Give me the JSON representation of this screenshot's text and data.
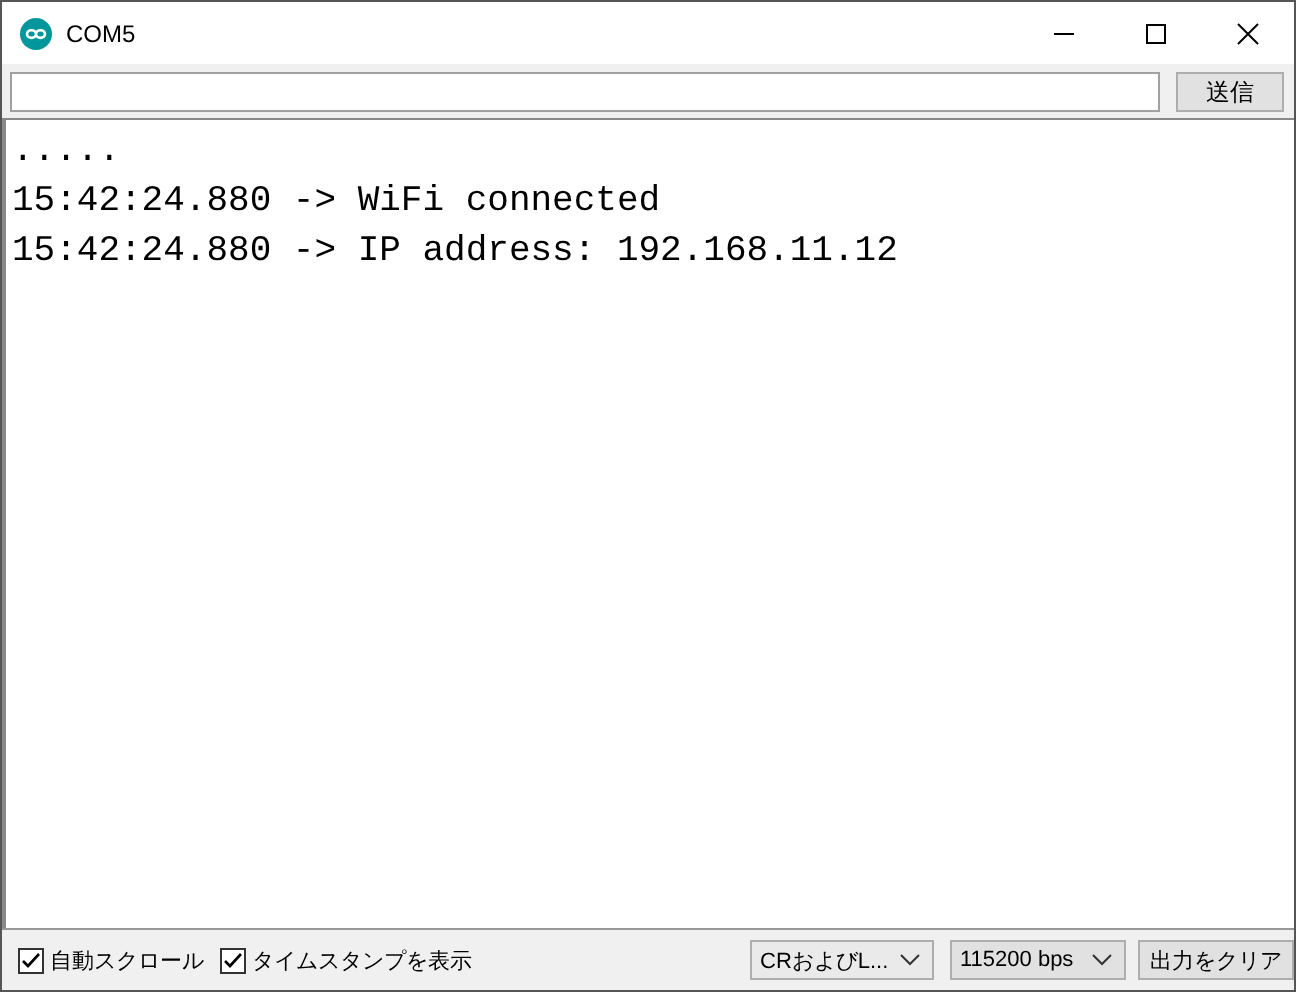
{
  "window": {
    "title": "COM5"
  },
  "send": {
    "button": "送信"
  },
  "output_lines": [
    ".....",
    "15:42:24.880 -> WiFi connected",
    "15:42:24.880 -> IP address: 192.168.11.12"
  ],
  "options": [
    {
      "label": "自動スクロール",
      "checked": true
    },
    {
      "label": "タイムスタンプを表示",
      "checked": true
    }
  ],
  "dropdowns": [
    {
      "value": "CRおよびL..."
    },
    {
      "value": "115200 bps"
    }
  ],
  "clear_button": "出力をクリア"
}
